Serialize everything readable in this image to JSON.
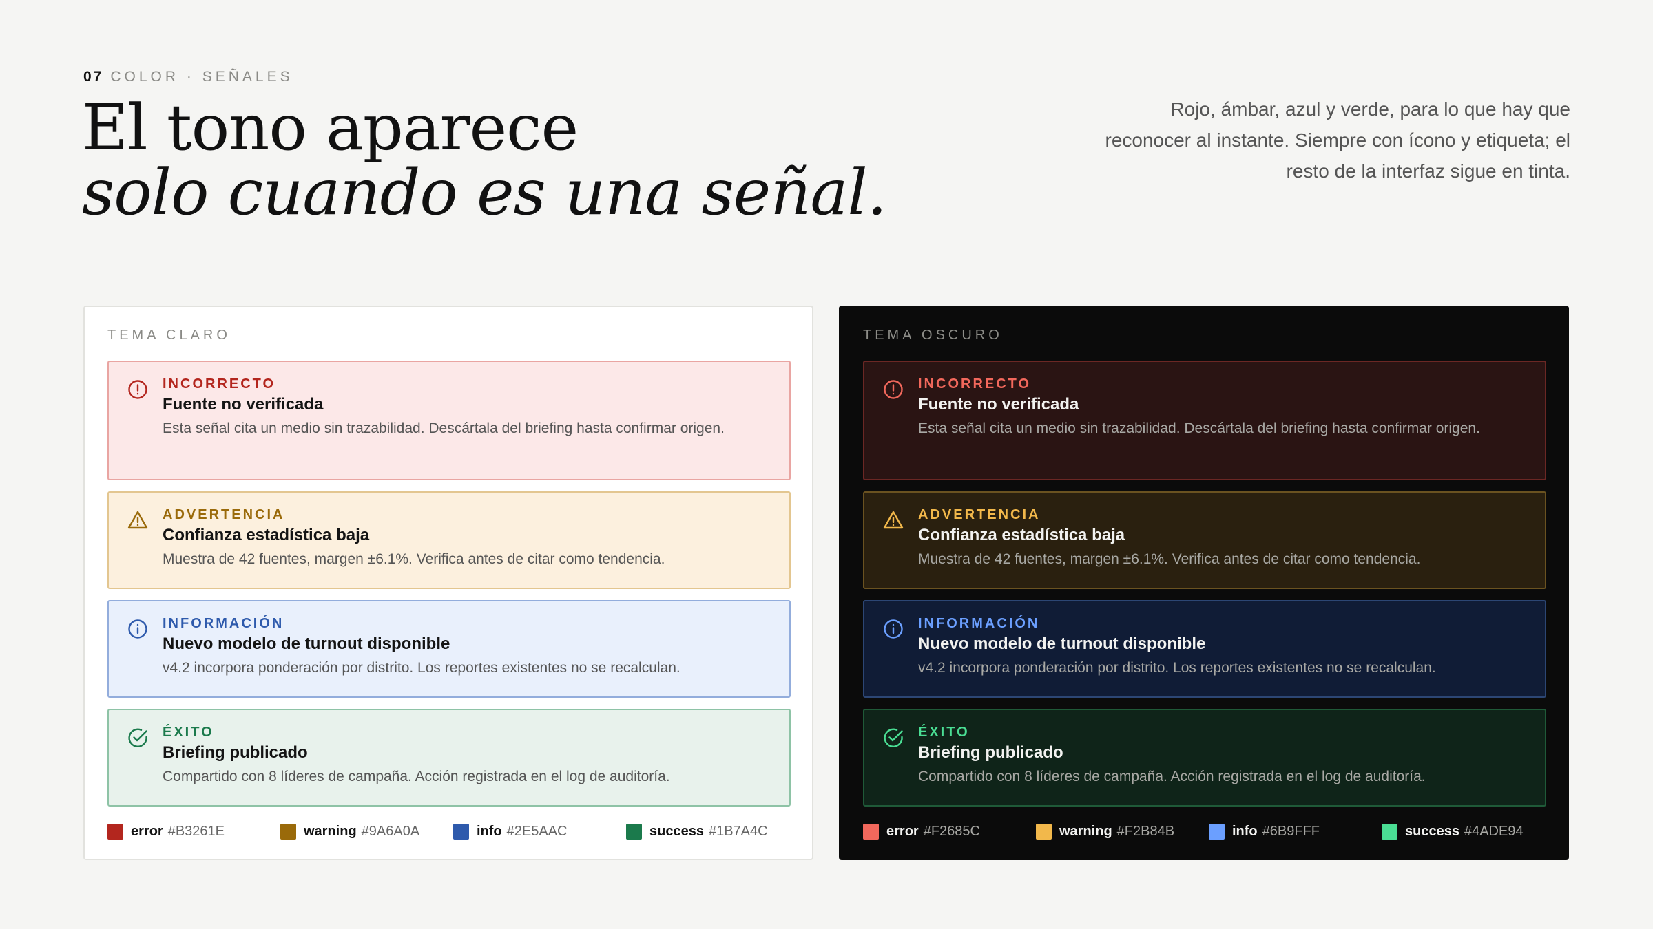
{
  "header": {
    "section_number": "07",
    "section_label": "COLOR · SEÑALES",
    "headline_line1": "El tono aparece",
    "headline_line2": "solo cuando es una señal.",
    "lede": "Rojo, ámbar, azul y verde, para lo que hay que reconocer al instante. Siempre con ícono y etiqueta; el resto de la interfaz sigue en tinta."
  },
  "colors": {
    "light": {
      "error": "#B3261E",
      "warning": "#9A6A0A",
      "info": "#2E5AAC",
      "success": "#1B7A4C"
    },
    "dark": {
      "error": "#F2685C",
      "warning": "#F2B84B",
      "info": "#6B9FFF",
      "success": "#4ADE94"
    }
  },
  "light_panel": {
    "title": "TEMA CLARO",
    "alerts": [
      {
        "icon": "alert-circle-icon",
        "kind": "INCORRECTO",
        "title": "Fuente no verificada",
        "description": "Esta señal cita un medio sin trazabilidad. Descártala del briefing hasta confirmar origen."
      },
      {
        "icon": "warning-triangle-icon",
        "kind": "ADVERTENCIA",
        "title": "Confianza estadística baja",
        "description": "Muestra de 42 fuentes, margen ±6.1%. Verifica antes de citar como tendencia."
      },
      {
        "icon": "info-circle-icon",
        "kind": "INFORMACIÓN",
        "title": "Nuevo modelo de turnout disponible",
        "description": "v4.2 incorpora ponderación por distrito. Los reportes existentes no se recalculan."
      },
      {
        "icon": "check-circle-icon",
        "kind": "ÉXITO",
        "title": "Briefing publicado",
        "description": "Compartido con 8 líderes de campaña. Acción registrada en el log de auditoría."
      }
    ],
    "legend": [
      {
        "name": "error",
        "hex": "#B3261E"
      },
      {
        "name": "warning",
        "hex": "#9A6A0A"
      },
      {
        "name": "info",
        "hex": "#2E5AAC"
      },
      {
        "name": "success",
        "hex": "#1B7A4C"
      }
    ]
  },
  "dark_panel": {
    "title": "TEMA OSCURO",
    "alerts": [
      {
        "icon": "alert-circle-icon",
        "kind": "INCORRECTO",
        "title": "Fuente no verificada",
        "description": "Esta señal cita un medio sin trazabilidad. Descártala del briefing hasta confirmar origen."
      },
      {
        "icon": "warning-triangle-icon",
        "kind": "ADVERTENCIA",
        "title": "Confianza estadística baja",
        "description": "Muestra de 42 fuentes, margen ±6.1%. Verifica antes de citar como tendencia."
      },
      {
        "icon": "info-circle-icon",
        "kind": "INFORMACIÓN",
        "title": "Nuevo modelo de turnout disponible",
        "description": "v4.2 incorpora ponderación por distrito. Los reportes existentes no se recalculan."
      },
      {
        "icon": "check-circle-icon",
        "kind": "ÉXITO",
        "title": "Briefing publicado",
        "description": "Compartido con 8 líderes de campaña. Acción registrada en el log de auditoría."
      }
    ],
    "legend": [
      {
        "name": "error",
        "hex": "#F2685C"
      },
      {
        "name": "warning",
        "hex": "#F2B84B"
      },
      {
        "name": "info",
        "hex": "#6B9FFF"
      },
      {
        "name": "success",
        "hex": "#4ADE94"
      }
    ]
  }
}
